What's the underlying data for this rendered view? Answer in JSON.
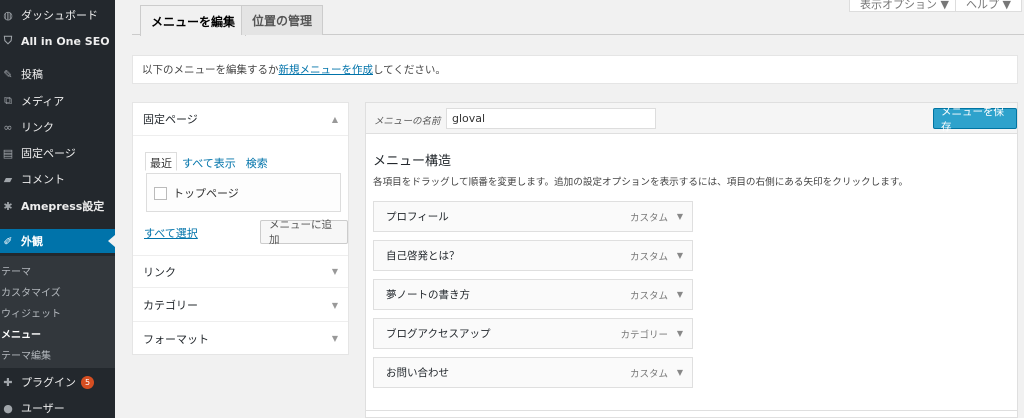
{
  "sidebar": {
    "items": [
      {
        "label": "ダッシュボード",
        "icon": "dashboard-icon",
        "glyph": "◍",
        "bold": false
      },
      {
        "label": "All in One SEO",
        "icon": "shield-icon",
        "glyph": "⛉",
        "bold": true
      },
      {
        "label": "投稿",
        "icon": "pin-icon",
        "glyph": "✎",
        "bold": false
      },
      {
        "label": "メディア",
        "icon": "media-icon",
        "glyph": "⧉",
        "bold": false
      },
      {
        "label": "リンク",
        "icon": "link-icon",
        "glyph": "∞",
        "bold": false
      },
      {
        "label": "固定ページ",
        "icon": "page-icon",
        "glyph": "▤",
        "bold": false
      },
      {
        "label": "コメント",
        "icon": "comment-icon",
        "glyph": "▰",
        "bold": false
      },
      {
        "label": "Amepress設定",
        "icon": "gear-icon",
        "glyph": "✱",
        "bold": true
      },
      {
        "label": "外観",
        "icon": "brush-icon",
        "glyph": "✐",
        "bold": true
      }
    ],
    "submenu": [
      "テーマ",
      "カスタマイズ",
      "ウィジェット",
      "メニュー",
      "テーマ編集"
    ],
    "bottom": [
      {
        "label": "プラグイン",
        "icon": "plugin-icon",
        "glyph": "✚",
        "badge": "5"
      },
      {
        "label": "ユーザー",
        "icon": "user-icon",
        "glyph": "●"
      }
    ]
  },
  "tabs": {
    "edit": "メニューを編集",
    "locations": "位置の管理"
  },
  "screen_options": {
    "display": "表示オプション ▼",
    "help": "ヘルプ ▼"
  },
  "notice": {
    "before": "以下のメニューを編集するか",
    "link": "新規メニューを作成",
    "after": "してください。"
  },
  "left": {
    "pages_title": "固定ページ",
    "inner_tabs": [
      "最近",
      "すべて表示",
      "検索"
    ],
    "checkbox_label": "トップページ",
    "select_all": "すべて選択",
    "add_button": "メニューに追加",
    "sections": [
      "リンク",
      "カテゴリー",
      "フォーマット"
    ]
  },
  "editor": {
    "name_label": "メニューの名前",
    "name_value": "gloval",
    "save_button": "メニューを保存",
    "structure_title": "メニュー構造",
    "structure_desc": "各項目をドラッグして順番を変更します。追加の設定オプションを表示するには、項目の右側にある矢印をクリックします。",
    "items": [
      {
        "title": "プロフィール",
        "type": "カスタム"
      },
      {
        "title": "自己啓発とは？",
        "type": "カスタム"
      },
      {
        "title": "夢ノートの書き方",
        "type": "カスタム"
      },
      {
        "title": "ブログアクセスアップ",
        "type": "カテゴリー"
      },
      {
        "title": "お問い合わせ",
        "type": "カスタム"
      }
    ]
  },
  "colors": {
    "sidebar": "#23282d",
    "accent": "#0073aa",
    "save_button": "#2ea2cc"
  }
}
